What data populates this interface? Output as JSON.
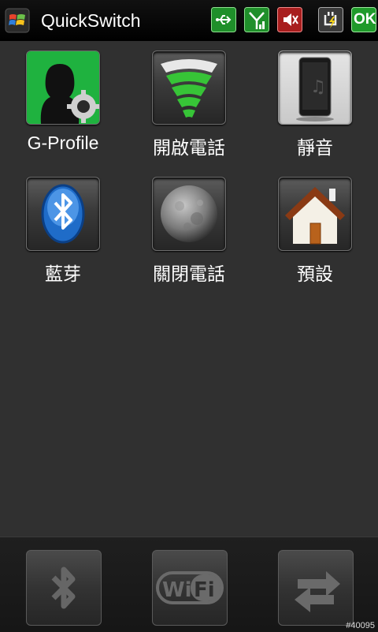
{
  "titlebar": {
    "app_title": "QuickSwitch",
    "icons": [
      "windows-start-icon",
      "usb-icon",
      "signal-icon",
      "speaker-muted-icon",
      "battery-charging-icon"
    ],
    "ok_label": "OK"
  },
  "grid": [
    {
      "label": "G-Profile",
      "icon": "g-profile-icon"
    },
    {
      "label": "開啟電話",
      "icon": "phone-on-signal-icon"
    },
    {
      "label": "靜音",
      "icon": "silent-phone-icon"
    },
    {
      "label": "藍芽",
      "icon": "bluetooth-icon"
    },
    {
      "label": "關閉電話",
      "icon": "moon-icon"
    },
    {
      "label": "預設",
      "icon": "home-icon"
    }
  ],
  "dock": {
    "items": [
      "bluetooth-toggle-icon",
      "wifi-toggle-icon",
      "sync-toggle-icon"
    ],
    "wifi_text": "WiFi"
  },
  "watermark": "#40095",
  "colors": {
    "accent_green": "#3fbf3f",
    "title_bg": "#000000",
    "body_bg": "#303030"
  }
}
